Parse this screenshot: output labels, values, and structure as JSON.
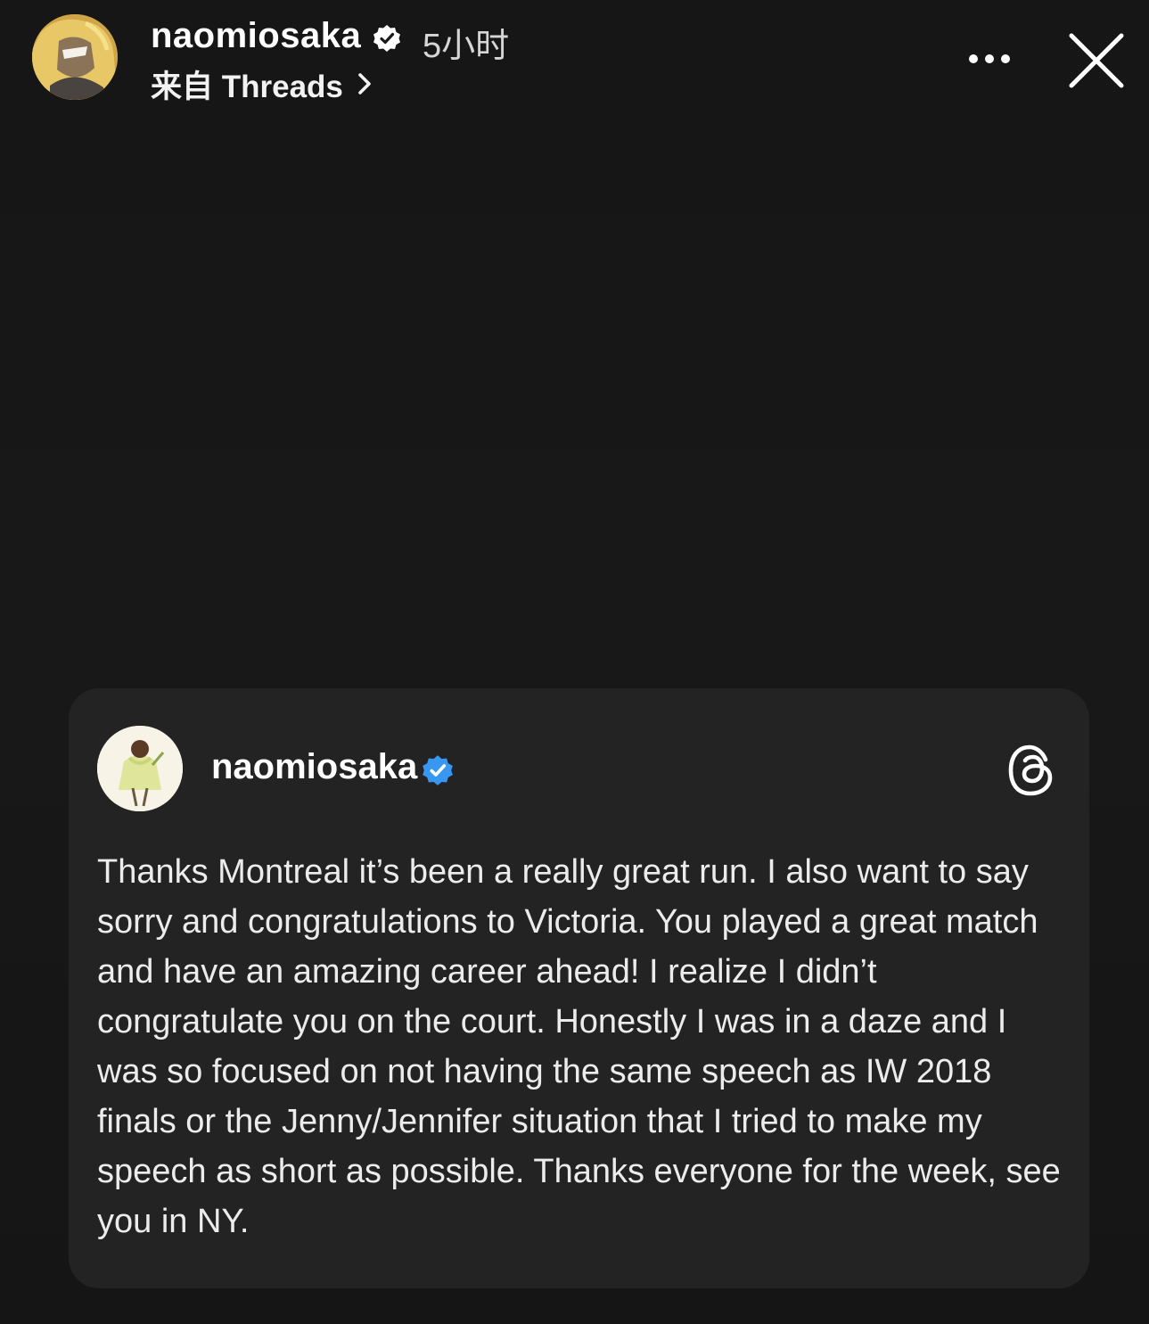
{
  "header": {
    "username": "naomiosaka",
    "time": "5小时",
    "source_label": "来自 Threads"
  },
  "icons": {
    "verified_header": "verified-badge-icon",
    "chevron": "chevron-right-icon",
    "more": "more-horizontal-icon",
    "close": "close-icon",
    "verified_card": "verified-badge-blue-icon",
    "threads": "threads-logo-icon"
  },
  "colors": {
    "background": "#181818",
    "card_background": "#232323",
    "verified_blue": "#3897f0",
    "text_primary": "#ffffff"
  },
  "card": {
    "username": "naomiosaka",
    "text": "Thanks Montreal it’s been a really great run. I also want to say sorry and congratulations to Victoria. You played a great match and have an amazing career ahead! I realize I didn’t congratulate you on the court. Honestly I was in a daze and I was so focused on not having the same speech as IW 2018 finals or the Jenny/Jennifer situation that I tried to make my speech as short as possible. Thanks everyone for the week, see you in NY."
  }
}
